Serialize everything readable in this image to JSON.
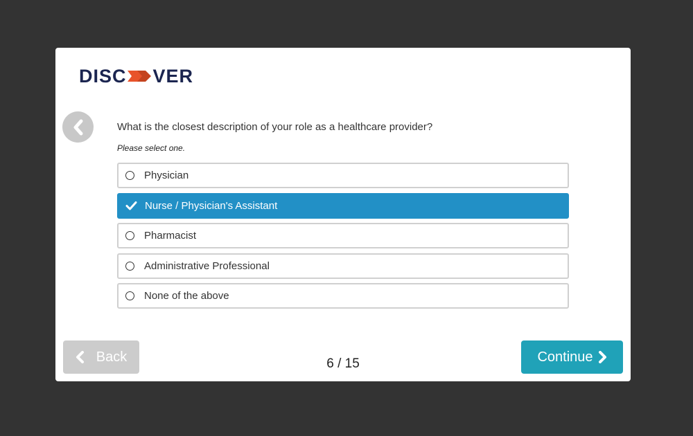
{
  "brand": {
    "logo_left": "DISC",
    "logo_right": "VER",
    "navy": "#1b2550",
    "orange": "#e8532a"
  },
  "survey": {
    "question": "What is the closest description of your role as a healthcare provider?",
    "hint": "Please select one.",
    "options": [
      {
        "label": "Physician",
        "selected": false
      },
      {
        "label": "Nurse / Physician's Assistant",
        "selected": true
      },
      {
        "label": "Pharmacist",
        "selected": false
      },
      {
        "label": "Administrative Professional",
        "selected": false
      },
      {
        "label": "None of the above",
        "selected": false
      }
    ],
    "selected_color": "#2290c6"
  },
  "footer": {
    "back_label": "Back",
    "continue_label": "Continue",
    "progress": "6 / 15",
    "continue_color": "#20a2b8",
    "back_color": "#cccccc"
  },
  "icons": {
    "round_back": "chevron-left-icon",
    "back": "chevron-left-icon",
    "continue": "chevron-right-icon",
    "selected": "checkmark-icon",
    "unselected": "radio-circle-icon"
  }
}
